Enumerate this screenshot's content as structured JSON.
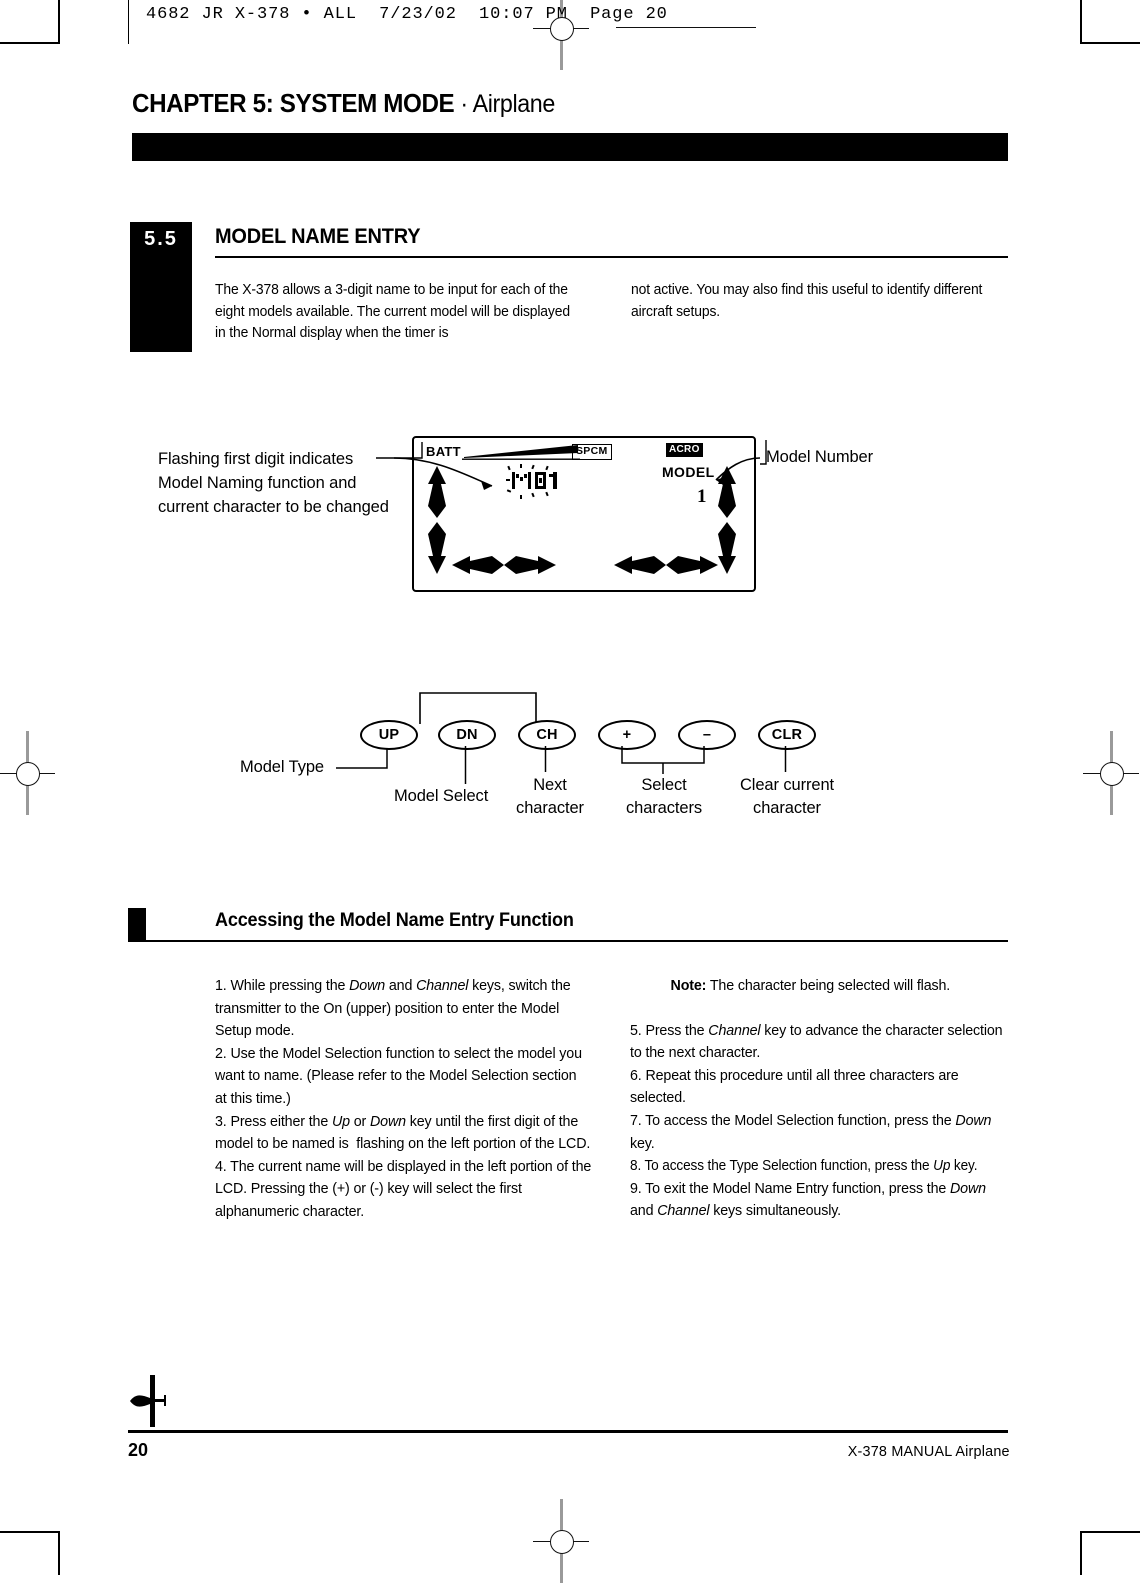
{
  "film_header": {
    "text": "4682 JR X-378 • ALL  7/23/02  10:07 PM  Page 20"
  },
  "chapter": {
    "title_bold": "CHAPTER 5: SYSTEM MODE",
    "title_separator": " · ",
    "title_regular": "Airplane"
  },
  "section": {
    "number": "5.5",
    "title": "MODEL NAME ENTRY",
    "intro_left": "The X-378 allows a 3-digit name to be input for each of the eight models available. The current model will be displayed in the Normal display when the timer is",
    "intro_right": "not active. You may also find this useful to identify different aircraft setups."
  },
  "lcd": {
    "batt_label": "BATT",
    "spcm_label": "SPCM",
    "acro_label": "ACRO",
    "model_label": "MODEL",
    "model_number_digit": "1",
    "name_display": "M01"
  },
  "callouts": {
    "left": "Flashing first digit indicates Model Naming function and current character to be changed",
    "right": "Model Number"
  },
  "keys": {
    "buttons": [
      {
        "name": "UP",
        "label": "UP"
      },
      {
        "name": "DN",
        "label": "DN"
      },
      {
        "name": "CH",
        "label": "CH"
      },
      {
        "name": "PLUS",
        "label": "+"
      },
      {
        "name": "MINUS",
        "label": "–"
      },
      {
        "name": "CLR",
        "label": "CLR"
      }
    ],
    "labels": {
      "model_type": "Model Type",
      "model_select": "Model Select",
      "next_character_line1": "Next",
      "next_character_line2": "character",
      "select_characters_line1": "Select",
      "select_characters_line2": "characters",
      "clear_character_line1": "Clear current",
      "clear_character_line2": "character"
    }
  },
  "subsection": {
    "title": "Accessing the Model Name Entry Function"
  },
  "steps_left": {
    "s1_a": "1. While pressing the ",
    "s1_i1": "Down",
    "s1_b": " and ",
    "s1_i2": "Channel",
    "s1_c": " keys, switch the transmitter to the On (upper) position to enter the Model Setup mode.",
    "s2": "2. Use the Model Selection function to select the model you want to name. (Please refer to the Model Selection section at this time.)",
    "s3_a": "3. Press either the ",
    "s3_i1": "Up",
    "s3_b": " or ",
    "s3_i2": "Down",
    "s3_c": " key until the first digit of the model to be named is  flashing on the left portion of the LCD.",
    "s4": "4. The current name will be displayed in the left portion of the LCD. Pressing the (+) or (-) key will select the first alphanumeric character."
  },
  "steps_right": {
    "note_label": "Note:",
    "note_text": " The character being selected will flash.",
    "s5_a": "5. Press the ",
    "s5_i1": "Channel",
    "s5_b": " key to advance the character selection to the next character.",
    "s6": "6. Repeat this procedure until all three characters are selected.",
    "s7_a": "7. To access the Model Selection function, press the ",
    "s7_i1": "Down",
    "s7_b": " key.",
    "s8_a": "8. To access the Type Selection function, press the ",
    "s8_i1": "Up",
    "s8_b": " key.",
    "s9_a": "9. To exit the Model Name Entry function, press the ",
    "s9_i1": "Down",
    "s9_b": " and ",
    "s9_i2": "Channel",
    "s9_c": " keys simultaneously."
  },
  "footer": {
    "page_number": "20",
    "manual_text": "X-378  MANUAL Airplane"
  }
}
